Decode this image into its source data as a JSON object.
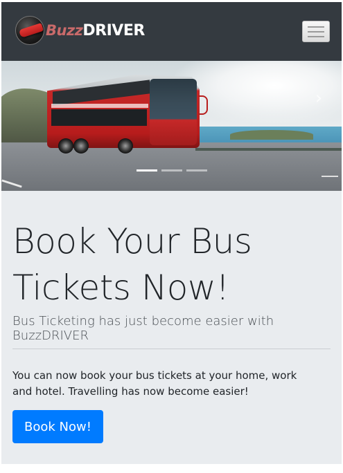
{
  "navbar": {
    "brand_part1": "Buzz",
    "brand_part2": "DRIVER",
    "logo_icon": "bus-logo-icon",
    "toggler_icon": "hamburger-menu-icon"
  },
  "carousel": {
    "next_icon": "chevron-right-icon",
    "next_glyph": "›",
    "indicators": [
      {
        "active": true
      },
      {
        "active": false
      },
      {
        "active": false
      }
    ]
  },
  "hero": {
    "title": "Book Your Bus Tickets Now!",
    "lead": "Bus Ticketing has just become easier with BuzzDRIVER",
    "description": "You can now book your bus tickets at your home, work and hotel. Travelling has now become easier!",
    "button_label": "Book Now!"
  },
  "colors": {
    "navbar_bg": "#343a40",
    "jumbotron_bg": "#e9ecef",
    "primary": "#007bff",
    "brand_accent": "#c96a6a"
  }
}
